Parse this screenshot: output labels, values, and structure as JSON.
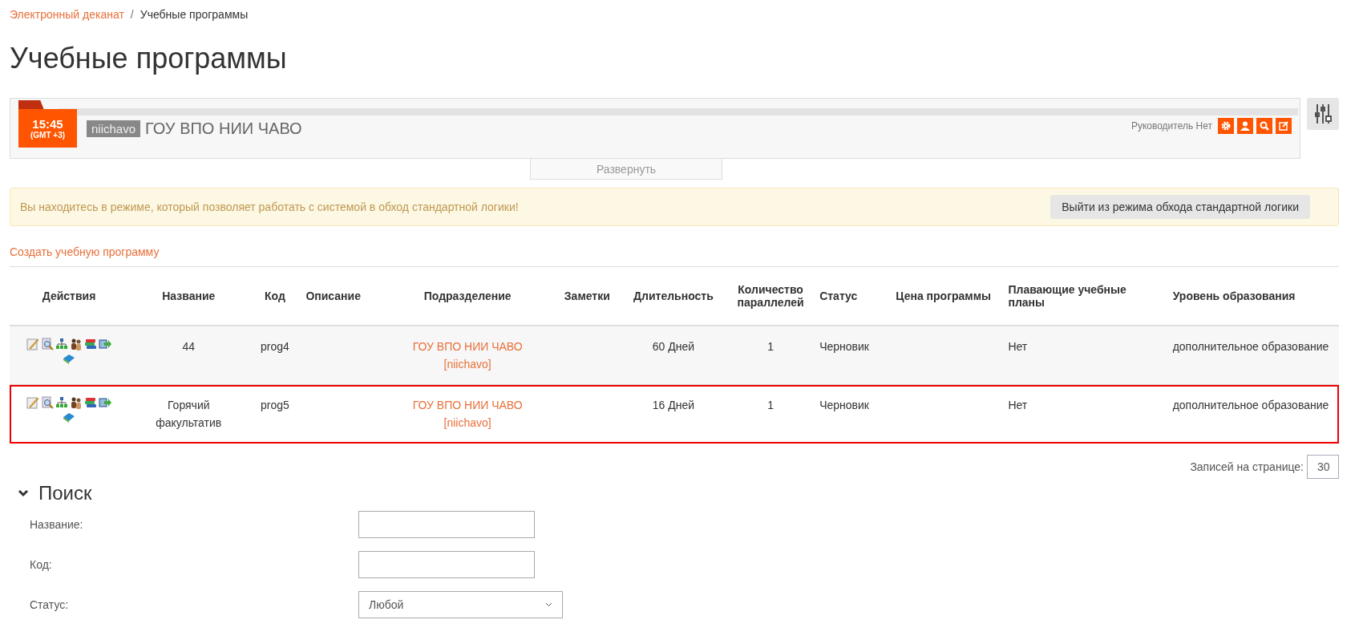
{
  "breadcrumb": [
    {
      "label": "Электронный деканат",
      "link": true
    },
    {
      "label": "Учебные программы",
      "link": false
    }
  ],
  "breadcrumb_separator": "/",
  "page_title": "Учебные программы",
  "header": {
    "time": "15:45",
    "timezone": "(GMT +3)",
    "org_code": "niichavo",
    "org_name": "ГОУ ВПО НИИ ЧАВО",
    "manager": "Руководитель Нет",
    "expand_label": "Развернуть"
  },
  "alert": {
    "message": "Вы находитесь в режиме, который позволяет работать с системой в обход стандартной логики!",
    "button": "Выйти из режима обхода стандартной логики"
  },
  "create_link": "Создать учебную программу",
  "table": {
    "columns": [
      "Действия",
      "Название",
      "Код",
      "Описание",
      "Подразделение",
      "Заметки",
      "Длительность",
      "Количество параллелей",
      "Статус",
      "Цена программы",
      "Плавающие учебные планы",
      "Уровень образования"
    ],
    "rows": [
      {
        "highlighted": false,
        "name": "44",
        "code": "prog4",
        "department": "ГОУ ВПО НИИ ЧАВО",
        "department_code": "[niichavo]",
        "duration": "60 Дней",
        "parallels": "1",
        "status": "Черновик",
        "floating_plans": "Нет",
        "level": "дополнительное образование"
      },
      {
        "highlighted": true,
        "name": "Горячий факультатив",
        "code": "prog5",
        "department": "ГОУ ВПО НИИ ЧАВО",
        "department_code": "[niichavo]",
        "duration": "16 Дней",
        "parallels": "1",
        "status": "Черновик",
        "floating_plans": "Нет",
        "level": "дополнительное образование"
      }
    ]
  },
  "per_page": {
    "label": "Записей на странице:",
    "value": "30"
  },
  "search": {
    "title": "Поиск",
    "expanded": true,
    "fields": [
      {
        "kind": "text",
        "label": "Название:"
      },
      {
        "kind": "text",
        "label": "Код:"
      },
      {
        "kind": "select",
        "label": "Статус:",
        "value": "Любой"
      }
    ]
  }
}
